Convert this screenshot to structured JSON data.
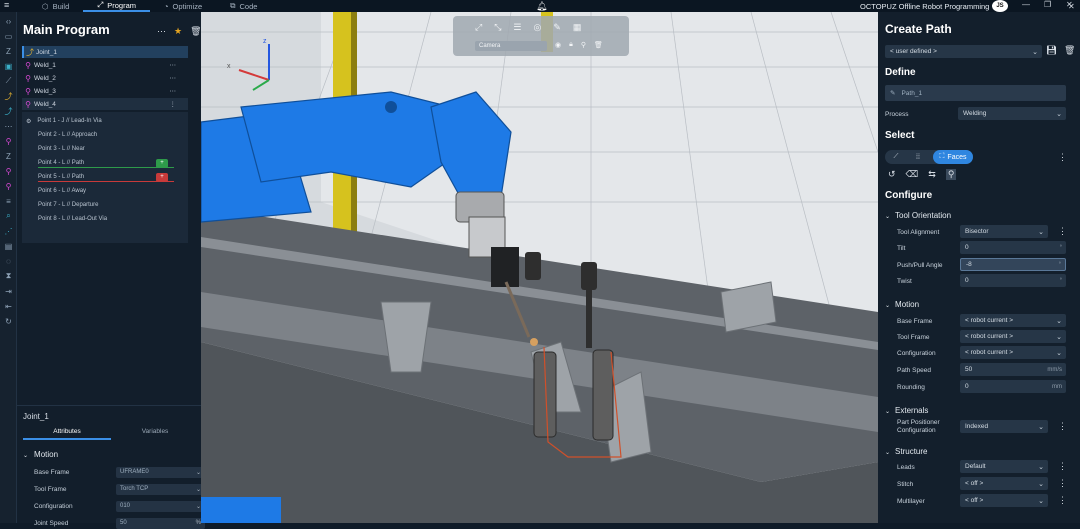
{
  "topbar": {
    "tabs": [
      {
        "label": "Build",
        "icon": "box-icon"
      },
      {
        "label": "Program",
        "icon": "path-icon"
      },
      {
        "label": "Optimize",
        "icon": "gauge-icon"
      },
      {
        "label": "Code",
        "icon": "code-icon"
      }
    ],
    "app_title": "OCTOPUZ Offline Robot Programming",
    "user_initials": "JS"
  },
  "program": {
    "title": "Main Program",
    "items": [
      {
        "label": "Joint_1"
      },
      {
        "label": "Weld_1"
      },
      {
        "label": "Weld_2"
      },
      {
        "label": "Weld_3"
      },
      {
        "label": "Weld_4"
      }
    ],
    "points": [
      {
        "label": "Point 1 - J // Lead-In Via"
      },
      {
        "label": "Point 2 - L // Approach"
      },
      {
        "label": "Point 3 - L // Near"
      },
      {
        "label": "Point 4 - L // Path",
        "badge": "+"
      },
      {
        "label": "Point 5 - L // Path",
        "badge": "+"
      },
      {
        "label": "Point 6 - L // Away"
      },
      {
        "label": "Point 7 - L // Departure"
      },
      {
        "label": "Point 8 - L // Lead-Out Via"
      }
    ]
  },
  "details": {
    "title": "Joint_1",
    "tabs": [
      "Attributes",
      "Variables"
    ],
    "section": "Motion",
    "rows": [
      {
        "label": "Base Frame",
        "value": "UFRAME0"
      },
      {
        "label": "Tool Frame",
        "value": "Torch TCP"
      },
      {
        "label": "Configuration",
        "value": "010"
      },
      {
        "label": "Joint Speed",
        "value": "50",
        "unit": "%"
      }
    ]
  },
  "viewport": {
    "camera_label": "Camera"
  },
  "create_path": {
    "title": "Create Path",
    "preset": "< user defined >",
    "define_heading": "Define",
    "path_name": "Path_1",
    "process_label": "Process",
    "process_value": "Welding",
    "select_heading": "Select",
    "select_mode": "Faces",
    "configure_heading": "Configure",
    "tool_orientation": {
      "title": "Tool Orientation",
      "rows": [
        {
          "label": "Tool Alignment",
          "value": "Bisector"
        },
        {
          "label": "Tilt",
          "value": "0"
        },
        {
          "label": "Push/Pull Angle",
          "value": "-8"
        },
        {
          "label": "Twist",
          "value": "0"
        }
      ]
    },
    "motion": {
      "title": "Motion",
      "rows": [
        {
          "label": "Base Frame",
          "value": "< robot current >"
        },
        {
          "label": "Tool Frame",
          "value": "< robot current >"
        },
        {
          "label": "Configuration",
          "value": "< robot current >"
        },
        {
          "label": "Path Speed",
          "value": "50",
          "unit": "mm/s"
        },
        {
          "label": "Rounding",
          "value": "0",
          "unit": "mm"
        }
      ]
    },
    "externals": {
      "title": "Externals",
      "rows": [
        {
          "label": "Part Positioner Configuration",
          "value": "Indexed"
        }
      ]
    },
    "structure": {
      "title": "Structure",
      "rows": [
        {
          "label": "Leads",
          "value": "Default"
        },
        {
          "label": "Stitch",
          "value": "< off >"
        },
        {
          "label": "Multilayer",
          "value": "< off >"
        }
      ]
    }
  },
  "colors": {
    "accent": "#2f86e0",
    "robot_blue": "#1e7ae6",
    "badge_green": "#2e9a4a",
    "badge_red": "#c83a3a",
    "program_magenta": "#d94ad6"
  }
}
